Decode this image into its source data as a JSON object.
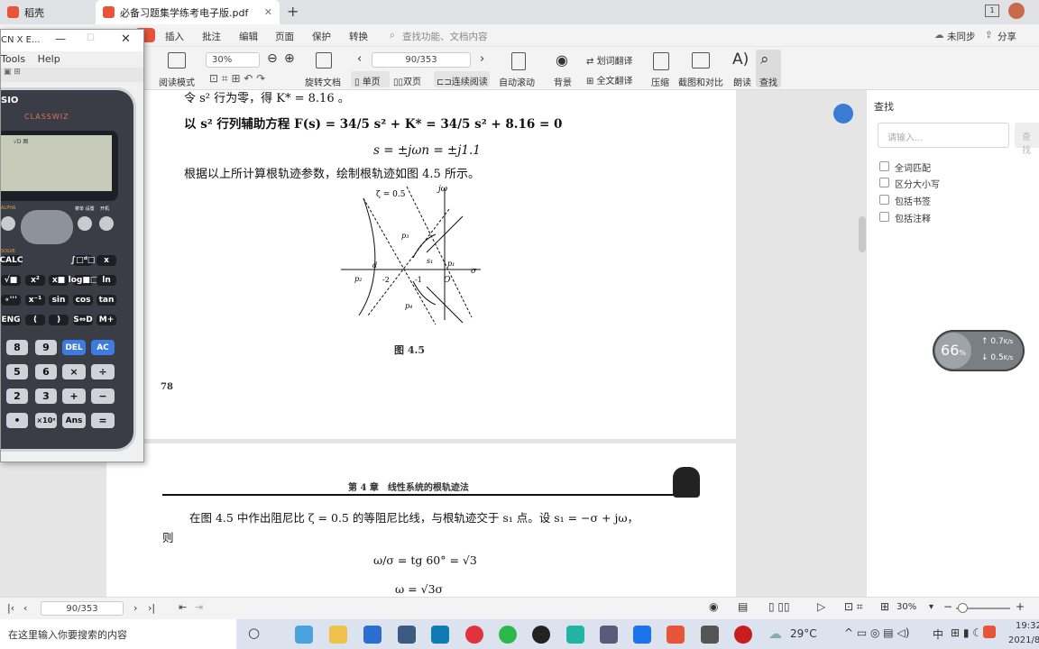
{
  "tabs": [
    {
      "label": "稻壳"
    },
    {
      "label": "必备习题集学练考电子版.pdf"
    }
  ],
  "window_controls": {
    "restore": "1"
  },
  "menu": {
    "items": [
      "插入",
      "批注",
      "编辑",
      "页面",
      "保护",
      "转换"
    ],
    "search_placeholder": "查找功能、文档内容",
    "sync": "未同步",
    "share": "分享"
  },
  "toolbar": {
    "read_mode": "阅读模式",
    "zoom": "30%",
    "rotate": "旋转文档",
    "page_nav": "90/353",
    "single": "单页",
    "double": "双页",
    "continuous": "连续阅读",
    "auto_scroll": "自动滚动",
    "background": "背景",
    "translate_select": "划词翻译",
    "translate_full": "全文翻译",
    "compress": "压缩",
    "screenshot": "截图和对比",
    "read_aloud": "朗读",
    "find": "查找"
  },
  "calculator": {
    "title": "CN X E...",
    "menu": [
      "Tools",
      "Help"
    ],
    "brand": "SIO",
    "model": "CLASSWIZ",
    "screen_indicator": "√D 图",
    "keys_row1": [
      "CALC",
      "∫□ᵈ□",
      "x"
    ],
    "keys_row2": [
      "√■",
      "x²",
      "x■",
      "log■□",
      "ln"
    ],
    "keys_row3": [
      "(-)",
      "∘'''",
      "x⁻¹",
      "sin",
      "cos",
      "tan"
    ],
    "keys_row4": [
      "ENG",
      "(",
      ")",
      "S⇔D",
      "M+"
    ],
    "keys_row5": [
      "8",
      "9",
      "DEL",
      "AC"
    ],
    "keys_row6": [
      "5",
      "6",
      "×",
      "÷"
    ],
    "keys_row7": [
      "2",
      "3",
      "+",
      "−"
    ],
    "keys_row8": [
      "•",
      "×10ˣ",
      "Ans",
      "="
    ],
    "labels": {
      "alpha": "ALPHA",
      "solve": "SOLVE",
      "menu_setup": "菜单 设置",
      "on": "开机"
    }
  },
  "page1": {
    "line0": "令 s² 行为零，得 K* = 8.16 。",
    "line1": "以 s² 行列辅助方程 F(s) = 34/5 s² + K* = 34/5 s² + 8.16 = 0",
    "line2": "s = ±jωn = ±j1.1",
    "line3": "根据以上所计算根轨迹参数，绘制根轨迹如图 4.5 所示。",
    "fig": {
      "zeta": "ζ = 0.5",
      "jw": "jω",
      "sigma": "σ",
      "p1": "p₁",
      "p2": "p₂",
      "p3": "p₃",
      "p4": "p₄",
      "s1": "s₁",
      "d": "d",
      "m2": "-2",
      "m1": "-1",
      "O": "O"
    },
    "caption": "图 4.5",
    "page_no": "78"
  },
  "page2": {
    "header": "第 4 章　线性系统的根轨迹法",
    "line1": "在图 4.5 中作出阻尼比 ζ = 0.5 的等阻尼比线，与根轨迹交于 s₁ 点。设 s₁ = −σ + jω，",
    "line2": "则",
    "eq1": "ω/σ = tg 60° = √3",
    "eq2": "ω = √3σ"
  },
  "find_panel": {
    "title": "查找",
    "placeholder": "请输入...",
    "button": "查找",
    "options": [
      "全词匹配",
      "区分大小写",
      "包括书签",
      "包括注释"
    ]
  },
  "net_widget": {
    "percent": "66",
    "unit": "%",
    "up": "0.7",
    "down": "0.5",
    "rate_unit": "K/s"
  },
  "status": {
    "page": "90/353",
    "zoom": "30%"
  },
  "taskbar": {
    "search": "在这里输入你要搜索的内容",
    "weather": "29°C",
    "time": "19:32",
    "date": "2021/8"
  }
}
